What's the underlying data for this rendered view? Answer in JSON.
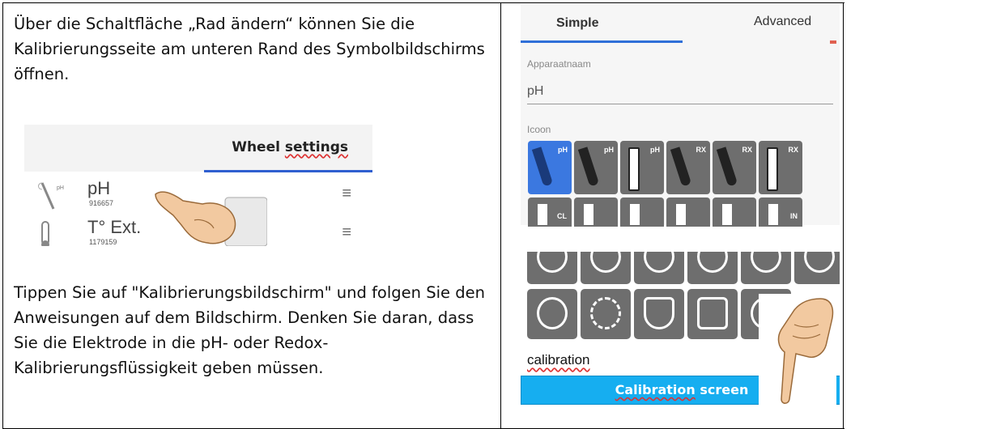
{
  "left": {
    "paragraph1": "Über die Schaltfläche „Rad ändern“ können Sie die Kalibrierungsseite am unteren Rand des Symbolbildschirms öffnen.",
    "paragraph2": "Tippen Sie auf \"Kalibrierungsbildschirm\" und folgen Sie den Anweisungen auf dem Bildschirm. Denken Sie daran, dass Sie die Elektrode in die pH- oder Redox-Kalibrierungsflüssigkeit geben müssen.",
    "wheel": {
      "title_a": "Wheel ",
      "title_b": "settings",
      "rows": [
        {
          "icon_tag": "pH",
          "name": "pH",
          "sub": "916657"
        },
        {
          "name": "T° Ext.",
          "sub": "1179159"
        }
      ]
    }
  },
  "right": {
    "tab_simple": "Simple",
    "tab_advanced": "Advanced",
    "device_label": "Apparaatnaam",
    "device_value": "pH",
    "icon_label": "Icoon",
    "icon_row1": [
      "pH",
      "pH",
      "pH",
      "RX",
      "RX",
      "RX"
    ],
    "icon_row2": [
      "CL",
      "",
      "",
      "",
      "",
      "IN"
    ],
    "calibration_label": "calibration",
    "calibration_button_a": "Calibration",
    "calibration_button_b": " screen"
  },
  "colors": {
    "tab_blue": "#2f6fd8",
    "button_blue": "#16aef0",
    "icon_gray": "#6e6e6e",
    "selected_blue": "#3b78e0"
  }
}
